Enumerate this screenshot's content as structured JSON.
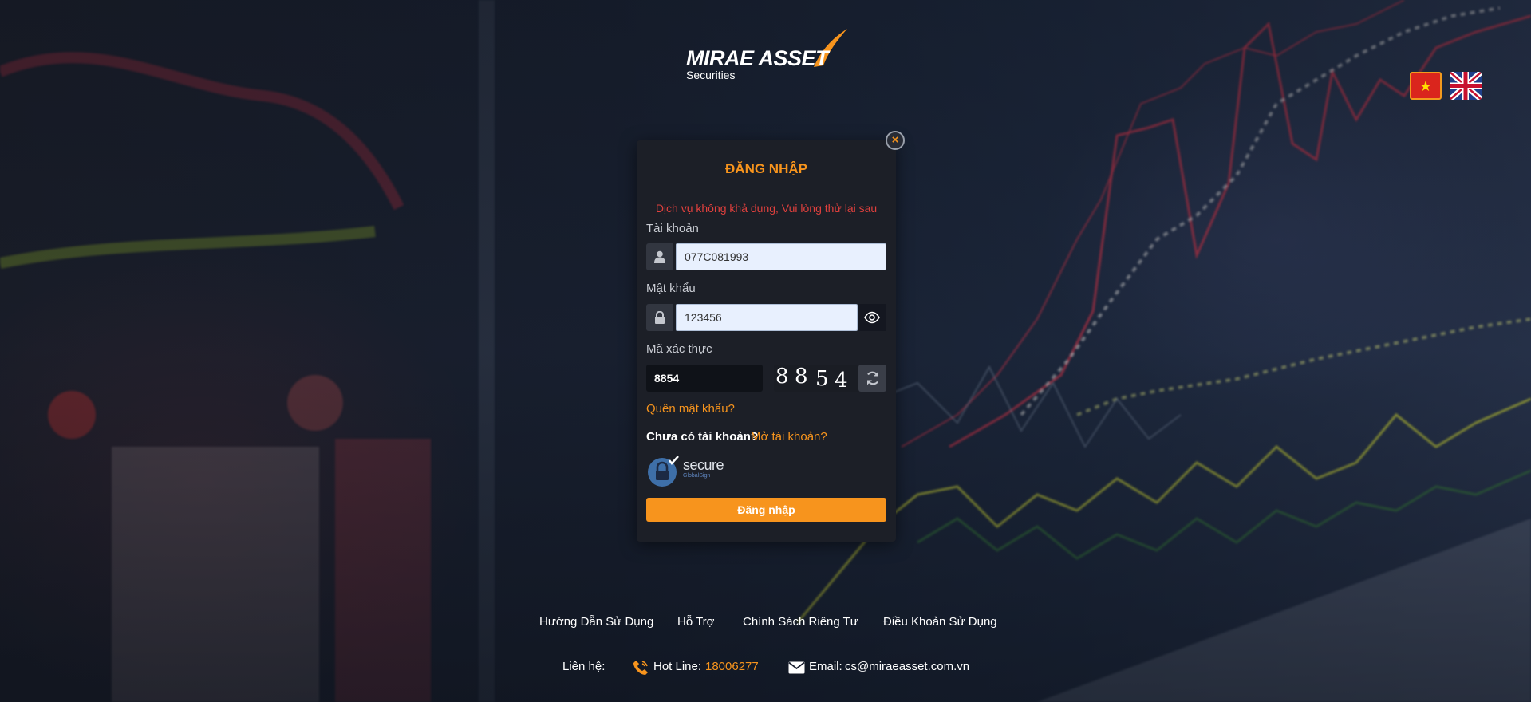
{
  "brand": {
    "name": "MIRAE ASSET",
    "sub": "Securities"
  },
  "languages": [
    {
      "code": "vi",
      "icon": "vietnam-flag-icon"
    },
    {
      "code": "en",
      "icon": "uk-flag-icon"
    }
  ],
  "login": {
    "title": "ĐĂNG NHẬP",
    "error": "Dịch vụ không khả dụng, Vui lòng thử lại sau",
    "account_label": "Tài khoản",
    "account_value": "077C081993",
    "password_label": "Mật khẩu",
    "password_value": "123456",
    "captcha_label": "Mã xác thực",
    "captcha_value": "8854",
    "captcha_digits": [
      "8",
      "8",
      "5",
      "4"
    ],
    "forgot": "Quên mật khẩu?",
    "no_account": "Chưa có tài khoản?",
    "open_account": "Mở tài khoản?",
    "secure_label": "secure",
    "secure_sub": "GlobalSign",
    "submit": "Đăng nhập",
    "close": "×"
  },
  "footer": {
    "links": [
      "Hướng Dẫn Sử Dụng",
      "Hỗ Trợ",
      "Chính Sách Riêng Tư",
      "Điều Khoản Sử Dụng"
    ],
    "contact_label": "Liên hệ:",
    "hotline_label": "Hot Line:",
    "hotline_number": "18006277",
    "email_label": "Email:",
    "email": "cs@miraeasset.com.vn"
  },
  "colors": {
    "accent": "#f7941d",
    "error": "#e0403d",
    "modal_bg": "#1c1f27"
  }
}
